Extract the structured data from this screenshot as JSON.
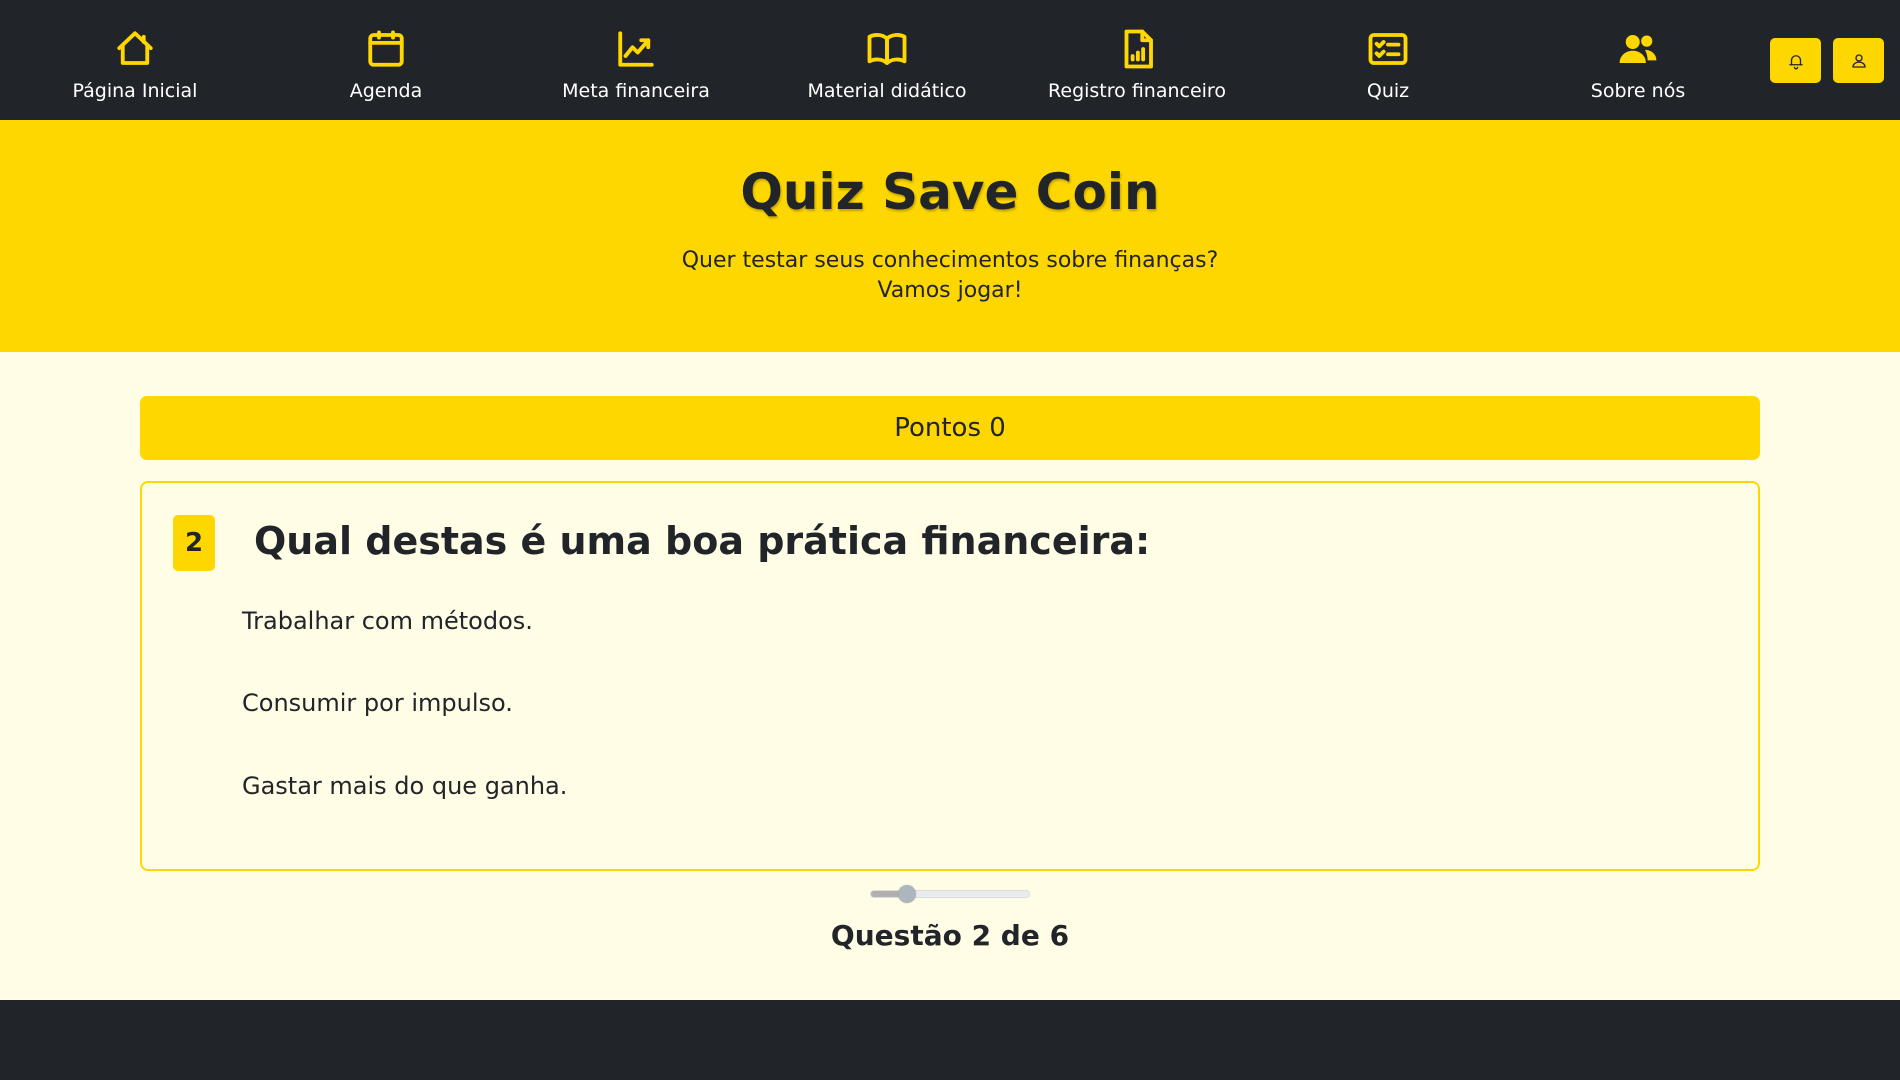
{
  "nav": {
    "items": [
      {
        "label": "Página Inicial",
        "icon": "house-icon"
      },
      {
        "label": "Agenda",
        "icon": "calendar-icon"
      },
      {
        "label": "Meta financeira",
        "icon": "chart-line-icon"
      },
      {
        "label": "Material didático",
        "icon": "book-icon"
      },
      {
        "label": "Registro financeiro",
        "icon": "document-chart-icon"
      },
      {
        "label": "Quiz",
        "icon": "checklist-icon"
      },
      {
        "label": "Sobre nós",
        "icon": "people-icon"
      }
    ],
    "notification_icon": "bell-icon",
    "user_icon": "person-icon"
  },
  "hero": {
    "title": "Quiz Save Coin",
    "subtitle_line1": "Quer testar seus conhecimentos sobre finanças?",
    "subtitle_line2": "Vamos jogar!"
  },
  "score": {
    "label": "Pontos 0"
  },
  "question": {
    "number": "2",
    "text": "Qual destas é uma boa prática financeira:",
    "answers": [
      "Trabalhar com métodos.",
      "Consumir por impulso.",
      "Gastar mais do que ganha."
    ]
  },
  "progress": {
    "current": 2,
    "total": 6,
    "fraction": 0.23,
    "label": "Questão 2 de 6"
  },
  "colors": {
    "accent": "#ffd700",
    "dark": "#212529",
    "background": "#fffde6"
  }
}
